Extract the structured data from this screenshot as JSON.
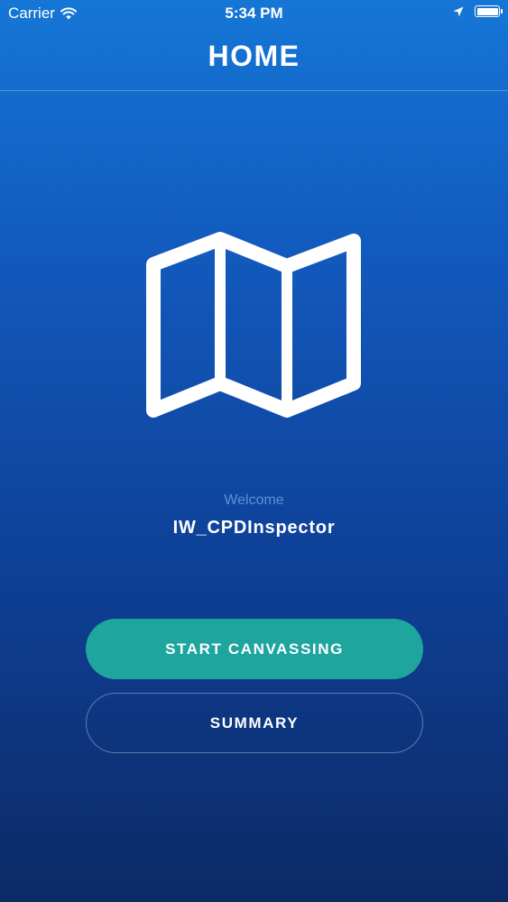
{
  "status_bar": {
    "carrier": "Carrier",
    "time": "5:34 PM",
    "icons": [
      "wifi-icon",
      "location-arrow-icon",
      "battery-icon"
    ],
    "battery_level": 1.0
  },
  "nav": {
    "title": "HOME"
  },
  "hero": {
    "icon": "map-icon",
    "welcome_label": "Welcome",
    "username": "IW_CPDInspector"
  },
  "actions": {
    "start_label": "START CANVASSING",
    "summary_label": "SUMMARY"
  },
  "colors": {
    "gradient_top": "#1576d6",
    "gradient_bottom": "#0c2a66",
    "primary_button": "#1ea59e",
    "welcome_text": "#5f8fd9",
    "text": "#ffffff"
  }
}
